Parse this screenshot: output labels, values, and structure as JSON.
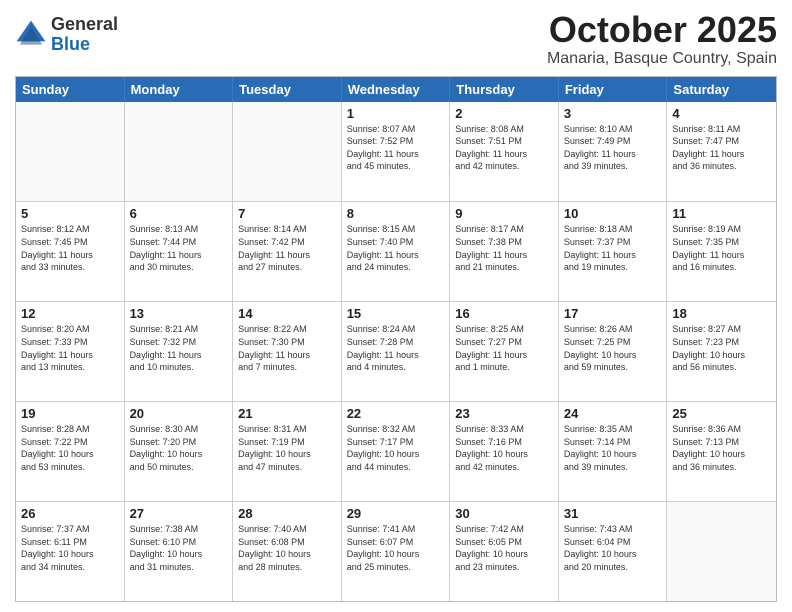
{
  "logo": {
    "general": "General",
    "blue": "Blue"
  },
  "title": "October 2025",
  "location": "Manaria, Basque Country, Spain",
  "headers": [
    "Sunday",
    "Monday",
    "Tuesday",
    "Wednesday",
    "Thursday",
    "Friday",
    "Saturday"
  ],
  "weeks": [
    [
      {
        "day": "",
        "info": ""
      },
      {
        "day": "",
        "info": ""
      },
      {
        "day": "",
        "info": ""
      },
      {
        "day": "1",
        "info": "Sunrise: 8:07 AM\nSunset: 7:52 PM\nDaylight: 11 hours\nand 45 minutes."
      },
      {
        "day": "2",
        "info": "Sunrise: 8:08 AM\nSunset: 7:51 PM\nDaylight: 11 hours\nand 42 minutes."
      },
      {
        "day": "3",
        "info": "Sunrise: 8:10 AM\nSunset: 7:49 PM\nDaylight: 11 hours\nand 39 minutes."
      },
      {
        "day": "4",
        "info": "Sunrise: 8:11 AM\nSunset: 7:47 PM\nDaylight: 11 hours\nand 36 minutes."
      }
    ],
    [
      {
        "day": "5",
        "info": "Sunrise: 8:12 AM\nSunset: 7:45 PM\nDaylight: 11 hours\nand 33 minutes."
      },
      {
        "day": "6",
        "info": "Sunrise: 8:13 AM\nSunset: 7:44 PM\nDaylight: 11 hours\nand 30 minutes."
      },
      {
        "day": "7",
        "info": "Sunrise: 8:14 AM\nSunset: 7:42 PM\nDaylight: 11 hours\nand 27 minutes."
      },
      {
        "day": "8",
        "info": "Sunrise: 8:15 AM\nSunset: 7:40 PM\nDaylight: 11 hours\nand 24 minutes."
      },
      {
        "day": "9",
        "info": "Sunrise: 8:17 AM\nSunset: 7:38 PM\nDaylight: 11 hours\nand 21 minutes."
      },
      {
        "day": "10",
        "info": "Sunrise: 8:18 AM\nSunset: 7:37 PM\nDaylight: 11 hours\nand 19 minutes."
      },
      {
        "day": "11",
        "info": "Sunrise: 8:19 AM\nSunset: 7:35 PM\nDaylight: 11 hours\nand 16 minutes."
      }
    ],
    [
      {
        "day": "12",
        "info": "Sunrise: 8:20 AM\nSunset: 7:33 PM\nDaylight: 11 hours\nand 13 minutes."
      },
      {
        "day": "13",
        "info": "Sunrise: 8:21 AM\nSunset: 7:32 PM\nDaylight: 11 hours\nand 10 minutes."
      },
      {
        "day": "14",
        "info": "Sunrise: 8:22 AM\nSunset: 7:30 PM\nDaylight: 11 hours\nand 7 minutes."
      },
      {
        "day": "15",
        "info": "Sunrise: 8:24 AM\nSunset: 7:28 PM\nDaylight: 11 hours\nand 4 minutes."
      },
      {
        "day": "16",
        "info": "Sunrise: 8:25 AM\nSunset: 7:27 PM\nDaylight: 11 hours\nand 1 minute."
      },
      {
        "day": "17",
        "info": "Sunrise: 8:26 AM\nSunset: 7:25 PM\nDaylight: 10 hours\nand 59 minutes."
      },
      {
        "day": "18",
        "info": "Sunrise: 8:27 AM\nSunset: 7:23 PM\nDaylight: 10 hours\nand 56 minutes."
      }
    ],
    [
      {
        "day": "19",
        "info": "Sunrise: 8:28 AM\nSunset: 7:22 PM\nDaylight: 10 hours\nand 53 minutes."
      },
      {
        "day": "20",
        "info": "Sunrise: 8:30 AM\nSunset: 7:20 PM\nDaylight: 10 hours\nand 50 minutes."
      },
      {
        "day": "21",
        "info": "Sunrise: 8:31 AM\nSunset: 7:19 PM\nDaylight: 10 hours\nand 47 minutes."
      },
      {
        "day": "22",
        "info": "Sunrise: 8:32 AM\nSunset: 7:17 PM\nDaylight: 10 hours\nand 44 minutes."
      },
      {
        "day": "23",
        "info": "Sunrise: 8:33 AM\nSunset: 7:16 PM\nDaylight: 10 hours\nand 42 minutes."
      },
      {
        "day": "24",
        "info": "Sunrise: 8:35 AM\nSunset: 7:14 PM\nDaylight: 10 hours\nand 39 minutes."
      },
      {
        "day": "25",
        "info": "Sunrise: 8:36 AM\nSunset: 7:13 PM\nDaylight: 10 hours\nand 36 minutes."
      }
    ],
    [
      {
        "day": "26",
        "info": "Sunrise: 7:37 AM\nSunset: 6:11 PM\nDaylight: 10 hours\nand 34 minutes."
      },
      {
        "day": "27",
        "info": "Sunrise: 7:38 AM\nSunset: 6:10 PM\nDaylight: 10 hours\nand 31 minutes."
      },
      {
        "day": "28",
        "info": "Sunrise: 7:40 AM\nSunset: 6:08 PM\nDaylight: 10 hours\nand 28 minutes."
      },
      {
        "day": "29",
        "info": "Sunrise: 7:41 AM\nSunset: 6:07 PM\nDaylight: 10 hours\nand 25 minutes."
      },
      {
        "day": "30",
        "info": "Sunrise: 7:42 AM\nSunset: 6:05 PM\nDaylight: 10 hours\nand 23 minutes."
      },
      {
        "day": "31",
        "info": "Sunrise: 7:43 AM\nSunset: 6:04 PM\nDaylight: 10 hours\nand 20 minutes."
      },
      {
        "day": "",
        "info": ""
      }
    ]
  ]
}
